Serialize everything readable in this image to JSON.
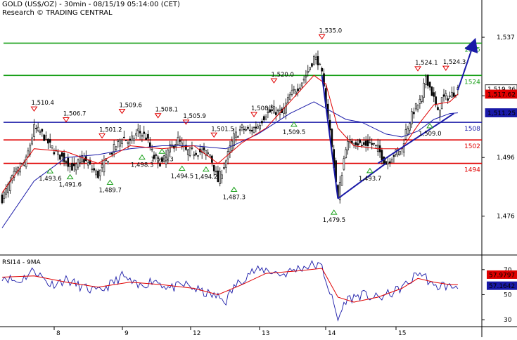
{
  "header": {
    "title": "GOLD (US$/OZ) - 30min - 08/15/19 05:14:00 (CET)",
    "source": "Research © TRADING CENTRAL"
  },
  "colors": {
    "candle": "#000000",
    "ma_fast": "#e00000",
    "ma_slow": "#1a1aa8",
    "support_resist_red": "#e00000",
    "resist_green": "#19a019",
    "pivot_blue": "#1a1aa8",
    "trend": "#1a1aa8",
    "price_badge_red": "#e00000",
    "price_badge_blue": "#1a1aa8"
  },
  "chart_data": {
    "type": "line",
    "price_axis": {
      "ylim": [
        1463,
        1543
      ],
      "ticks": [
        1537,
        1517,
        1496,
        1476
      ],
      "tick_labels": [
        "1,537",
        "1,517",
        "1,496",
        "1,476"
      ]
    },
    "date_axis": {
      "labels": [
        "8",
        "9",
        "12",
        "13",
        "14",
        "15"
      ]
    },
    "levels": [
      {
        "value": 1535,
        "label": "1535",
        "color": "#19a019"
      },
      {
        "value": 1524,
        "label": "1524",
        "color": "#19a019"
      },
      {
        "value": 1508,
        "label": "1508",
        "color": "#1a1aa8"
      },
      {
        "value": 1502,
        "label": "1502",
        "color": "#e00000"
      },
      {
        "value": 1494,
        "label": "1494",
        "color": "#e00000"
      }
    ],
    "price_badges": [
      {
        "label": "1,519.36",
        "value": 1519.36,
        "style": "white"
      },
      {
        "label": "1,517.62",
        "value": 1517.62,
        "style": "red"
      },
      {
        "label": "1,511.25",
        "value": 1511.25,
        "style": "blue"
      }
    ],
    "close_path": [
      [
        0,
        1482
      ],
      [
        3,
        1490
      ],
      [
        6,
        1495
      ],
      [
        8,
        1506
      ],
      [
        10,
        1504
      ],
      [
        12,
        1500
      ],
      [
        14,
        1497
      ],
      [
        16,
        1495
      ],
      [
        18,
        1492
      ],
      [
        20,
        1496
      ],
      [
        22,
        1493
      ],
      [
        24,
        1490
      ],
      [
        26,
        1495
      ],
      [
        28,
        1499
      ],
      [
        30,
        1503
      ],
      [
        32,
        1501
      ],
      [
        34,
        1505
      ],
      [
        36,
        1503
      ],
      [
        38,
        1496
      ],
      [
        40,
        1494
      ],
      [
        42,
        1499
      ],
      [
        44,
        1502
      ],
      [
        46,
        1498
      ],
      [
        48,
        1498
      ],
      [
        50,
        1498
      ],
      [
        52,
        1497
      ],
      [
        54,
        1488
      ],
      [
        56,
        1495
      ],
      [
        58,
        1503
      ],
      [
        60,
        1506
      ],
      [
        62,
        1505
      ],
      [
        64,
        1507
      ],
      [
        66,
        1511
      ],
      [
        68,
        1512
      ],
      [
        70,
        1511
      ],
      [
        72,
        1517
      ],
      [
        74,
        1520
      ],
      [
        76,
        1524
      ],
      [
        78,
        1530
      ],
      [
        79,
        1529
      ],
      [
        80,
        1524
      ],
      [
        82,
        1505
      ],
      [
        84,
        1482
      ],
      [
        86,
        1500
      ],
      [
        88,
        1502
      ],
      [
        90,
        1500
      ],
      [
        92,
        1501
      ],
      [
        94,
        1499
      ],
      [
        96,
        1494
      ],
      [
        98,
        1497
      ],
      [
        100,
        1499
      ],
      [
        101,
        1505
      ],
      [
        103,
        1512
      ],
      [
        104,
        1514
      ],
      [
        105,
        1516
      ],
      [
        106,
        1524
      ],
      [
        108,
        1516
      ],
      [
        109,
        1511
      ],
      [
        110,
        1516
      ],
      [
        112,
        1517
      ],
      [
        114,
        1519.36
      ]
    ],
    "ma_fast": [
      [
        0,
        1484
      ],
      [
        8,
        1499
      ],
      [
        16,
        1498
      ],
      [
        24,
        1494
      ],
      [
        32,
        1500
      ],
      [
        40,
        1499
      ],
      [
        48,
        1500
      ],
      [
        54,
        1494
      ],
      [
        60,
        1501
      ],
      [
        66,
        1506
      ],
      [
        72,
        1515
      ],
      [
        78,
        1524
      ],
      [
        81,
        1521
      ],
      [
        84,
        1506
      ],
      [
        88,
        1500
      ],
      [
        94,
        1499
      ],
      [
        100,
        1499
      ],
      [
        104,
        1507
      ],
      [
        108,
        1514
      ],
      [
        112,
        1515
      ],
      [
        114,
        1517.62
      ]
    ],
    "ma_slow": [
      [
        0,
        1472
      ],
      [
        8,
        1488
      ],
      [
        16,
        1496
      ],
      [
        24,
        1497
      ],
      [
        32,
        1499
      ],
      [
        40,
        1500
      ],
      [
        48,
        1500
      ],
      [
        56,
        1499
      ],
      [
        64,
        1504
      ],
      [
        72,
        1511
      ],
      [
        78,
        1515
      ],
      [
        82,
        1512
      ],
      [
        86,
        1509
      ],
      [
        90,
        1508
      ],
      [
        96,
        1504
      ],
      [
        100,
        1503
      ],
      [
        104,
        1505
      ],
      [
        108,
        1509
      ],
      [
        112,
        1511
      ],
      [
        114,
        1511.25
      ]
    ],
    "trendlines": [
      {
        "from": [
          84,
          1482
        ],
        "to": [
          80,
          1524
        ]
      },
      {
        "from": [
          84,
          1482
        ],
        "to": [
          96,
          1494
        ]
      },
      {
        "from": [
          94,
          1494
        ],
        "to": [
          113,
          1511
        ]
      },
      {
        "from": [
          114,
          1519
        ],
        "to": [
          118,
          1535
        ],
        "arrow": true
      }
    ],
    "annotations": [
      {
        "label": "1,510.4",
        "x": 8,
        "y": 1510.4,
        "kind": "high"
      },
      {
        "label": "1,506.7",
        "x": 16,
        "y": 1506.7,
        "kind": "high"
      },
      {
        "label": "1,501.2",
        "x": 25,
        "y": 1501.2,
        "kind": "high"
      },
      {
        "label": "1,509.6",
        "x": 30,
        "y": 1509.6,
        "kind": "high"
      },
      {
        "label": "1,508.1",
        "x": 39,
        "y": 1508.1,
        "kind": "high"
      },
      {
        "label": "1,505.9",
        "x": 46,
        "y": 1505.9,
        "kind": "high"
      },
      {
        "label": "1,501.5",
        "x": 53,
        "y": 1501.5,
        "kind": "high"
      },
      {
        "label": "1,508.5",
        "x": 63,
        "y": 1508.5,
        "kind": "high"
      },
      {
        "label": "1,520.0",
        "x": 68,
        "y": 1520.0,
        "kind": "high"
      },
      {
        "label": "1,535.0",
        "x": 80,
        "y": 1535.0,
        "kind": "high"
      },
      {
        "label": "1,524.1",
        "x": 104,
        "y": 1524.1,
        "kind": "high"
      },
      {
        "label": "1,524.3",
        "x": 111,
        "y": 1524.3,
        "kind": "high"
      },
      {
        "label": "1,493.6",
        "x": 12,
        "y": 1493.6,
        "kind": "low"
      },
      {
        "label": "1,491.6",
        "x": 17,
        "y": 1491.6,
        "kind": "low"
      },
      {
        "label": "1,489.7",
        "x": 27,
        "y": 1489.7,
        "kind": "low"
      },
      {
        "label": "1,498.3",
        "x": 35,
        "y": 1498.3,
        "kind": "low"
      },
      {
        "label": "1,500.3",
        "x": 40,
        "y": 1500.3,
        "kind": "low"
      },
      {
        "label": "1,494.5",
        "x": 45,
        "y": 1494.5,
        "kind": "low"
      },
      {
        "label": "1,494.2",
        "x": 51,
        "y": 1494.2,
        "kind": "low"
      },
      {
        "label": "1,487.3",
        "x": 58,
        "y": 1487.3,
        "kind": "low"
      },
      {
        "label": "1,509.5",
        "x": 73,
        "y": 1509.5,
        "kind": "low"
      },
      {
        "label": "1,479.5",
        "x": 83,
        "y": 1479.5,
        "kind": "low"
      },
      {
        "label": "1,493.7",
        "x": 92,
        "y": 1493.7,
        "kind": "low"
      },
      {
        "label": "1,509.0",
        "x": 107,
        "y": 1509.0,
        "kind": "low"
      }
    ],
    "rsi": {
      "title": "RSI14 - 9MA",
      "ylim": [
        25,
        80
      ],
      "ticks": [
        70,
        50,
        30
      ],
      "tick_labels": [
        "70",
        "50",
        "30"
      ],
      "badges": [
        {
          "label": "57.1642",
          "value": 57.1642,
          "style": "blue"
        },
        {
          "label": "57.9797",
          "value": 66,
          "style": "red"
        }
      ],
      "rsi_path": [
        [
          0,
          65
        ],
        [
          4,
          60
        ],
        [
          8,
          70
        ],
        [
          12,
          58
        ],
        [
          16,
          62
        ],
        [
          20,
          56
        ],
        [
          24,
          52
        ],
        [
          28,
          60
        ],
        [
          30,
          65
        ],
        [
          34,
          56
        ],
        [
          38,
          62
        ],
        [
          42,
          55
        ],
        [
          46,
          58
        ],
        [
          50,
          52
        ],
        [
          54,
          48
        ],
        [
          56,
          45
        ],
        [
          58,
          56
        ],
        [
          62,
          68
        ],
        [
          66,
          70
        ],
        [
          70,
          66
        ],
        [
          74,
          71
        ],
        [
          78,
          74
        ],
        [
          80,
          72
        ],
        [
          82,
          52
        ],
        [
          84,
          30
        ],
        [
          86,
          46
        ],
        [
          90,
          50
        ],
        [
          94,
          47
        ],
        [
          98,
          52
        ],
        [
          102,
          60
        ],
        [
          104,
          68
        ],
        [
          106,
          64
        ],
        [
          108,
          55
        ],
        [
          110,
          58
        ],
        [
          112,
          56
        ],
        [
          114,
          57.16
        ]
      ],
      "ma_path": [
        [
          0,
          64
        ],
        [
          8,
          65
        ],
        [
          16,
          60
        ],
        [
          24,
          56
        ],
        [
          32,
          60
        ],
        [
          40,
          58
        ],
        [
          48,
          55
        ],
        [
          54,
          50
        ],
        [
          60,
          58
        ],
        [
          66,
          67
        ],
        [
          74,
          69
        ],
        [
          80,
          71
        ],
        [
          84,
          48
        ],
        [
          88,
          44
        ],
        [
          94,
          48
        ],
        [
          100,
          55
        ],
        [
          104,
          63
        ],
        [
          108,
          60
        ],
        [
          112,
          58
        ],
        [
          114,
          58
        ]
      ]
    }
  }
}
